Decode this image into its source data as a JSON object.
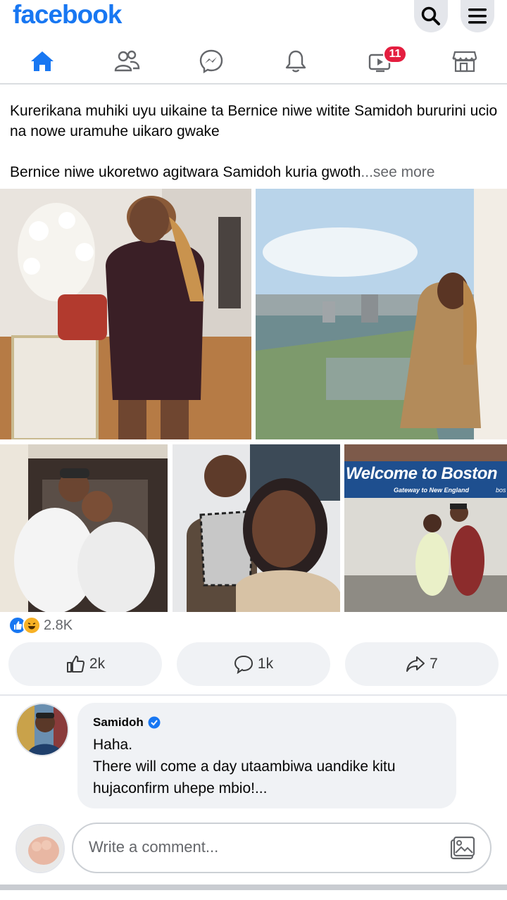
{
  "header": {
    "logo": "facebook",
    "search_icon": "search-icon",
    "menu_icon": "menu-icon"
  },
  "nav": {
    "items": [
      {
        "name": "home",
        "icon": "home-icon",
        "active": true
      },
      {
        "name": "friends",
        "icon": "friends-icon"
      },
      {
        "name": "messenger",
        "icon": "messenger-icon"
      },
      {
        "name": "notifications",
        "icon": "bell-icon"
      },
      {
        "name": "watch",
        "icon": "video-icon",
        "badge": "11"
      },
      {
        "name": "marketplace",
        "icon": "store-icon"
      }
    ],
    "accent": "#1877f2",
    "badge_color": "#e41e3f"
  },
  "post": {
    "paragraph1": "Kurerikana muhiki uyu uikaine ta Bernice niwe witite Samidoh bururini ucio na nowe uramuhe uikaro gwake",
    "paragraph2": "Bernice niwe ukoretwo agitwara Samidoh kuria gwoth",
    "see_more": "...see more",
    "photo4_sign_title": "Welcome to Boston",
    "photo4_sign_subtitle": "Gateway to New England",
    "photo4_sign_right": "bos",
    "reaction_count": "2.8K",
    "actions": {
      "like_count": "2k",
      "comment_count": "1k",
      "share_count": "7"
    }
  },
  "comment": {
    "author": "Samidoh",
    "verified": true,
    "line1": "Haha.",
    "line2": "There will come a day utaambiwa uandike kitu hujaconfirm uhepe mbio!..."
  },
  "composer": {
    "placeholder": "Write a comment..."
  }
}
